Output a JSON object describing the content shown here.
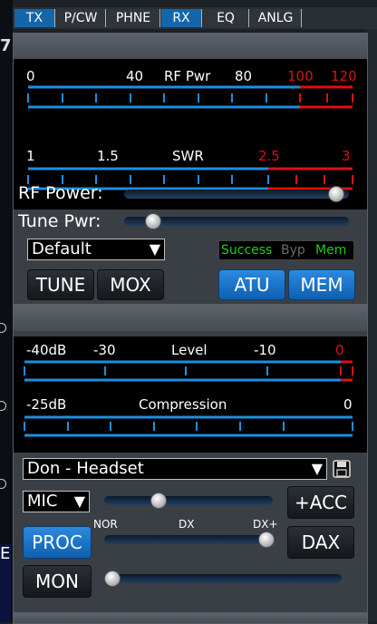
{
  "tabs": [
    "TX",
    "P/CW",
    "PHNE",
    "RX",
    "EQ",
    "ANLG"
  ],
  "left_edge": {
    "mark_top": "7",
    "mark_bottom": "E"
  },
  "tx": {
    "rf_meter": {
      "title": "RF Pwr",
      "ticks": [
        "0",
        "40",
        "80",
        "100",
        "120"
      ]
    },
    "swr_meter": {
      "title": "SWR",
      "ticks": [
        "1",
        "1.5",
        "2.5",
        "3"
      ]
    },
    "rf_power_label": "RF Power:",
    "rf_power_value": 0.97,
    "tune_pwr_label": "Tune Pwr:",
    "tune_pwr_value": 0.1,
    "profile": "Default",
    "tune_label": "TUNE",
    "mox_label": "MOX",
    "atu_status": {
      "success": "Success",
      "byp": "Byp",
      "mem": "Mem"
    },
    "atu_label": "ATU",
    "mem_label": "MEM",
    "colors": {
      "success": "#19d119",
      "byp": "#6b6b6b",
      "mem": "#19d119",
      "blue_button": "#1f7ad0",
      "meter_red": "#e01010",
      "meter_blue": "#1e8fe0"
    }
  },
  "phone": {
    "level_meter": {
      "title": "Level",
      "ticks": [
        "-40dB",
        "-30",
        "-10",
        "0"
      ]
    },
    "comp_meter": {
      "title": "Compression",
      "ticks": [
        "-25dB",
        "0"
      ]
    },
    "profile": "Don - Headset",
    "mic_source": "MIC",
    "mic_level_value": 0.3,
    "acc_label": "+ACC",
    "proc_label": "PROC",
    "proc_labels": [
      "NOR",
      "DX",
      "DX+"
    ],
    "proc_value": 1.0,
    "dax_label": "DAX",
    "mon_label": "MON",
    "mon_value": 0.0
  },
  "icons": {
    "save": "save-icon",
    "dropdown": "chevron-down-icon"
  }
}
